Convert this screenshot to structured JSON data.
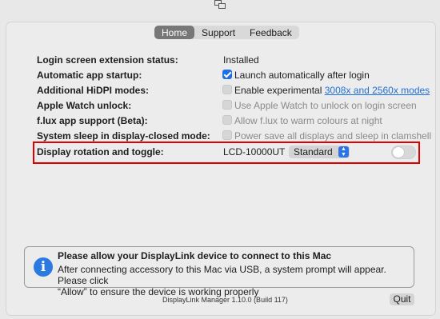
{
  "titlebar": {
    "icon": "display-link-icon"
  },
  "tabs": [
    {
      "label": "Home",
      "active": true
    },
    {
      "label": "Support",
      "active": false
    },
    {
      "label": "Feedback",
      "active": false
    }
  ],
  "rows": {
    "login_status": {
      "label": "Login screen extension status:",
      "value": "Installed"
    },
    "auto_startup": {
      "label": "Automatic app startup:",
      "checkbox": "Launch automatically after login",
      "checked": true
    },
    "hidpi": {
      "label": "Additional HiDPI modes:",
      "checkbox": "Enable experimental",
      "link": "3008x and 2560x modes",
      "checked": false
    },
    "watch": {
      "label": "Apple Watch unlock:",
      "checkbox": "Use Apple Watch to unlock on login screen",
      "checked": false
    },
    "flux": {
      "label": "f.lux app support (Beta):",
      "checkbox": "Allow f.lux to warm colours at night",
      "checked": false
    },
    "sleep": {
      "label": "System sleep in display-closed mode:",
      "checkbox": "Power save all displays and sleep in clamshell",
      "checked": false
    },
    "rotation": {
      "label": "Display rotation and toggle:",
      "device": "LCD-10000UT",
      "select": "Standard",
      "toggle_on": false
    }
  },
  "info": {
    "icon": "info-icon",
    "title": "Please allow your DisplayLink device to connect to this Mac",
    "line1": "After connecting accessory to this Mac via USB, a system prompt will appear. Please click",
    "line2": "“Allow” to ensure the device is working properly"
  },
  "footer": {
    "version": "DisplayLink Manager 1.10.0 (Build 117)",
    "quit": "Quit"
  },
  "colors": {
    "accent": "#1e6fe6",
    "highlight": "#e00000"
  }
}
